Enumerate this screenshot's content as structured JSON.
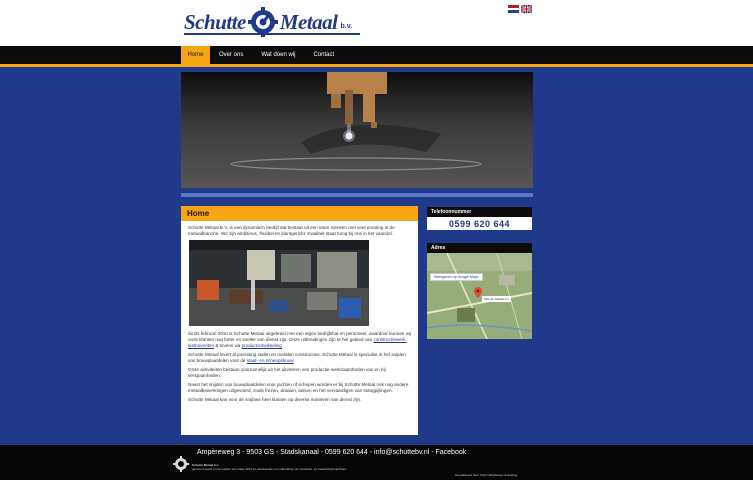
{
  "brand": {
    "logo_text_left": "Schutte",
    "logo_text_right": "Metaal",
    "logo_suffix": "b.v.",
    "colors": {
      "primary": "#1f3a8a",
      "accent": "#f5a412",
      "dark": "#0c0c0c"
    }
  },
  "languages": [
    {
      "code": "nl",
      "icon": "dutch-flag-icon"
    },
    {
      "code": "en",
      "icon": "uk-flag-icon"
    }
  ],
  "nav": {
    "items": [
      {
        "label": "Home",
        "active": true
      },
      {
        "label": "Over ons",
        "active": false
      },
      {
        "label": "Wat doen wij",
        "active": false
      },
      {
        "label": "Contact",
        "active": false
      }
    ]
  },
  "content": {
    "title": "Home",
    "intro": "Schutte Metaal B.V. is een dynamisch bedrijf dat bestaat uit een team mensen met veel ervaring in de metaalbranche. We zijn ambitieus, flexibel en klantgericht. Kwaliteit staat hoog bij ons in het vaandel.",
    "p2_text": "Sinds februari 2010 is Schutte Metaal uitgebreid met een eigen bedrijfshal en personeel, waardoor kunnen wij onze klanten nog beter en sneller van dienst zijn. Onze uitbreidingen zijn te het gebied van",
    "p2_link1": "constructiewerk, lasthoveriten",
    "p2_mid": "& tevens via",
    "p2_link2": "productontwikkeling",
    "p3_text": "Schutte Metaal levert al jarenlang stalen en metalen constructies. Schutte Metaal is specialist in het snijden van bouwplaatdelen voor de",
    "p3_link": "staal- en scheepsbouw",
    "p4": "Onze activiteiten bestaan voornamelijk uit het uitvoeren van productie-werkzaamheden van en bij verspaanheden.",
    "p5": "Naast het snijden van bouwplaatdelen voor jachten of schepen worden er bij Schutte Metaal ook nog andere metaalbewerkingen uitgevoerd, zoals frezen, draaien, lassen en het vervaardigen van stangpijlingen.",
    "p6": "Schutte Metaal kan voor de snijfase heel klanten op diverse manieren van dienst zijn."
  },
  "sidebar": {
    "phone_title": "Telefoonnummer",
    "phone": "0599 620 644",
    "address_title": "Adres",
    "map_link": "Weergeven op Google Maps",
    "map_badge": "Schutte Metaal b.v."
  },
  "footer": {
    "address": "Ampèreweg 3 - 9503 GS - Stadskanaal - 0599 620 644 - info@schuttebv.nl - Facebook",
    "note_title": "Schutte Metaal b.v.",
    "note": "gerenommeerd in het snijden van staal. 2013 en aanstaande met uitbreiding van productie- en bewerkingsmachines",
    "credit": "Gerealiseerd door Tolpin Webdesign & Hosting"
  }
}
